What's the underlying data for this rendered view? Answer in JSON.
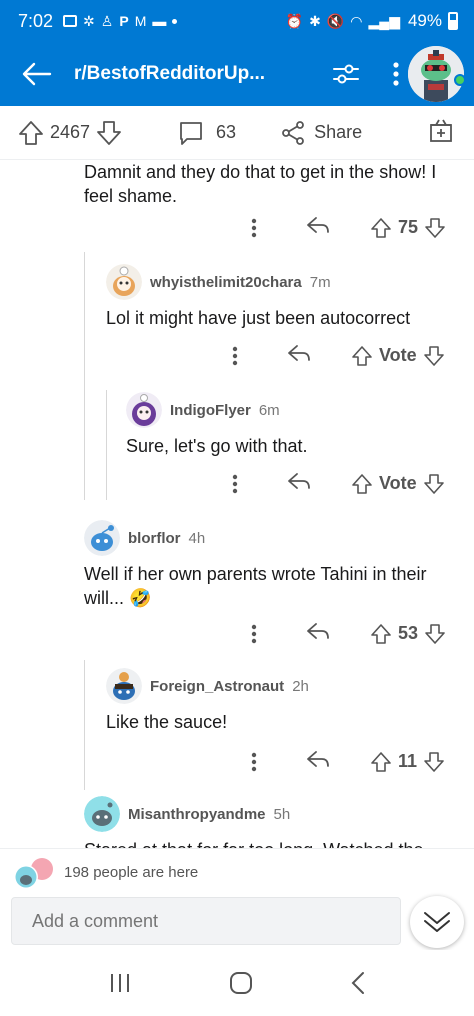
{
  "status_bar": {
    "time": "7:02",
    "battery": "49%"
  },
  "header": {
    "title": "r/BestofRedditorUp..."
  },
  "post_actions": {
    "score": "2467",
    "comments": "63",
    "share": "Share"
  },
  "comments": [
    {
      "username": "",
      "age": "",
      "body": "Damnit and they do that to get in the show! I feel shame.",
      "score": "75"
    },
    {
      "username": "whyisthelimit20chara",
      "age": "7m",
      "body": "Lol it might have just been autocorrect",
      "score": "Vote"
    },
    {
      "username": "IndigoFlyer",
      "age": "6m",
      "body": "Sure, let's go with that.",
      "score": "Vote"
    },
    {
      "username": "blorflor",
      "age": "4h",
      "body": "Well if her own parents wrote Tahini in their will... 🤣",
      "score": "53"
    },
    {
      "username": "Foreign_Astronaut",
      "age": "2h",
      "body": "Like the sauce!",
      "score": "11"
    },
    {
      "username": "Misanthropyandme",
      "age": "5h",
      "body": "Stared at that for far too long. Watched the",
      "score": ""
    }
  ],
  "presence": {
    "text": "198 people are here"
  },
  "compose": {
    "placeholder": "Add a comment"
  },
  "colors": {
    "brand_blue": "#0079d3",
    "online": "#46d160",
    "text": "#1a1a1b",
    "rail": "#d7d7d7"
  }
}
